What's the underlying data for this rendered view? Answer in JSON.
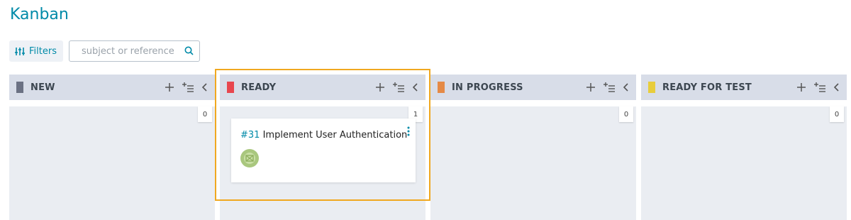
{
  "page": {
    "title": "Kanban"
  },
  "toolbar": {
    "filters_label": "Filters",
    "search_placeholder": "subject or reference"
  },
  "columns": [
    {
      "title": "NEW",
      "color": "#6b7183",
      "count": "0"
    },
    {
      "title": "READY",
      "color": "#e8464e",
      "count": "1"
    },
    {
      "title": "IN PROGRESS",
      "color": "#e58a46",
      "count": "0"
    },
    {
      "title": "READY FOR TEST",
      "color": "#e8cd3c",
      "count": "0"
    }
  ],
  "cards": [
    {
      "column": "READY",
      "ref": "#31",
      "subject": "Implement User Authentication"
    }
  ],
  "icons": {
    "column_actions": [
      "add-icon",
      "bulk-add-icon",
      "fold-column-icon"
    ],
    "toolbar": [
      "filter-sliders-icon",
      "search-icon"
    ],
    "card": [
      "more-options-icon",
      "user-avatar-icon"
    ]
  },
  "accent_colors": {
    "brand": "#008aa8",
    "highlight": "#f0a820"
  }
}
